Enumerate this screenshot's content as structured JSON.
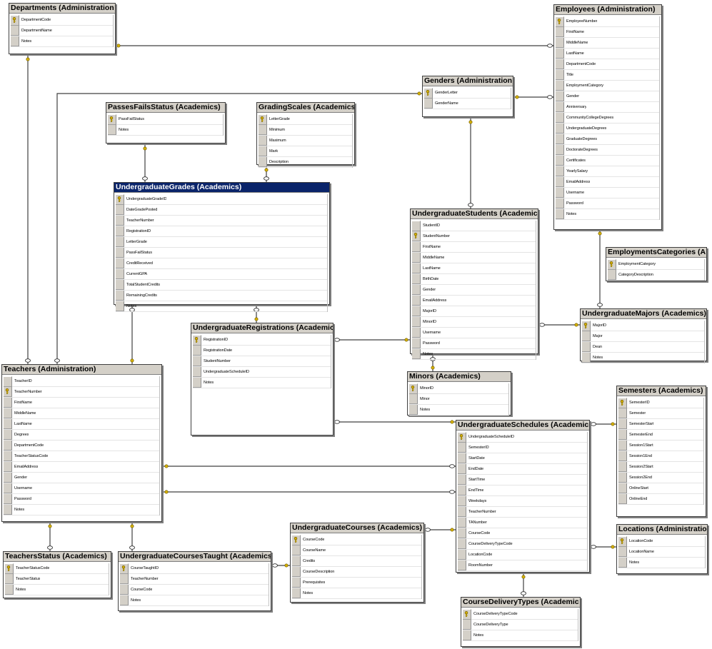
{
  "tables": [
    {
      "id": "departments",
      "title": "Departments (Administration",
      "columns": [
        {
          "name": "DepartmentCode",
          "pk": true
        },
        {
          "name": "DepartmentName",
          "pk": false
        },
        {
          "name": "Notes",
          "pk": false
        }
      ]
    },
    {
      "id": "employees",
      "title": "Employees (Administration)",
      "columns": [
        {
          "name": "EmployeeNumber",
          "pk": true
        },
        {
          "name": "FirstName",
          "pk": false
        },
        {
          "name": "MiddleName",
          "pk": false
        },
        {
          "name": "LastName",
          "pk": false
        },
        {
          "name": "DepartmentCode",
          "pk": false
        },
        {
          "name": "Title",
          "pk": false
        },
        {
          "name": "EmploymentCategory",
          "pk": false
        },
        {
          "name": "Gender",
          "pk": false
        },
        {
          "name": "Anniversary",
          "pk": false
        },
        {
          "name": "CommunityCollegeDegrees",
          "pk": false
        },
        {
          "name": "UndergraduateDegrees",
          "pk": false
        },
        {
          "name": "GraduateDegrees",
          "pk": false
        },
        {
          "name": "DoctorateDegrees",
          "pk": false
        },
        {
          "name": "Certificates",
          "pk": false
        },
        {
          "name": "YearlySalary",
          "pk": false
        },
        {
          "name": "EmailAddress",
          "pk": false
        },
        {
          "name": "Username",
          "pk": false
        },
        {
          "name": "Password",
          "pk": false
        },
        {
          "name": "Notes",
          "pk": false
        }
      ]
    },
    {
      "id": "genders",
      "title": "Genders (Administration",
      "columns": [
        {
          "name": "GenderLetter",
          "pk": true
        },
        {
          "name": "GenderName",
          "pk": false
        }
      ]
    },
    {
      "id": "passes",
      "title": "PassesFailsStatus (Academics)",
      "columns": [
        {
          "name": "PassFailStatus",
          "pk": true
        },
        {
          "name": "Notes",
          "pk": false
        }
      ]
    },
    {
      "id": "grading",
      "title": "GradingScales (Academics)",
      "columns": [
        {
          "name": "LetterGrade",
          "pk": true
        },
        {
          "name": "Minimum",
          "pk": false
        },
        {
          "name": "Maximum",
          "pk": false
        },
        {
          "name": "Mark",
          "pk": false
        },
        {
          "name": "Description",
          "pk": false
        }
      ]
    },
    {
      "id": "ugrades",
      "title": "UndergraduateGrades (Academics)",
      "selected": true,
      "columns": [
        {
          "name": "UndergraduateGradeID",
          "pk": true
        },
        {
          "name": "DateGradePosted",
          "pk": false
        },
        {
          "name": "TeacherNumber",
          "pk": false
        },
        {
          "name": "RegistrationID",
          "pk": false
        },
        {
          "name": "LetterGrade",
          "pk": false
        },
        {
          "name": "PassFailStatus",
          "pk": false
        },
        {
          "name": "CreditReceived",
          "pk": false
        },
        {
          "name": "CurrentGPA",
          "pk": false
        },
        {
          "name": "TotalStudentCredits",
          "pk": false
        },
        {
          "name": "RemainingCredits",
          "pk": false
        },
        {
          "name": "Notes",
          "pk": false
        }
      ]
    },
    {
      "id": "ustudents",
      "title": "UndergraduateStudents (Academics",
      "columns": [
        {
          "name": "StudentID",
          "pk": false
        },
        {
          "name": "StudentNumber",
          "pk": true
        },
        {
          "name": "FirstName",
          "pk": false
        },
        {
          "name": "MiddleName",
          "pk": false
        },
        {
          "name": "LastName",
          "pk": false
        },
        {
          "name": "BirthDate",
          "pk": false
        },
        {
          "name": "Gender",
          "pk": false
        },
        {
          "name": "EmailAddress",
          "pk": false
        },
        {
          "name": "MajorID",
          "pk": false
        },
        {
          "name": "MinorID",
          "pk": false
        },
        {
          "name": "Username",
          "pk": false
        },
        {
          "name": "Password",
          "pk": false
        },
        {
          "name": "Notes",
          "pk": false
        }
      ]
    },
    {
      "id": "empcat",
      "title": "EmploymentsCategories (A",
      "columns": [
        {
          "name": "EmploymentCategory",
          "pk": true
        },
        {
          "name": "CategoryDescription",
          "pk": false
        }
      ]
    },
    {
      "id": "umajors",
      "title": "UndergraduateMajors (Academics)",
      "columns": [
        {
          "name": "MajorID",
          "pk": true
        },
        {
          "name": "Major",
          "pk": false
        },
        {
          "name": "Dean",
          "pk": false
        },
        {
          "name": "Notes",
          "pk": false
        }
      ]
    },
    {
      "id": "uregs",
      "title": "UndergraduateRegistrations (Academic",
      "columns": [
        {
          "name": "RegistrationID",
          "pk": true
        },
        {
          "name": "RegistrationDate",
          "pk": false
        },
        {
          "name": "StudentNumber",
          "pk": false
        },
        {
          "name": "UndergraduateScheduleID",
          "pk": false
        },
        {
          "name": "Notes",
          "pk": false
        }
      ]
    },
    {
      "id": "teachers",
      "title": "Teachers (Administration)",
      "columns": [
        {
          "name": "TeacherID",
          "pk": false
        },
        {
          "name": "TeacherNumber",
          "pk": true
        },
        {
          "name": "FirstName",
          "pk": false
        },
        {
          "name": "MiddleName",
          "pk": false
        },
        {
          "name": "LastName",
          "pk": false
        },
        {
          "name": "Degrees",
          "pk": false
        },
        {
          "name": "DepartmentCode",
          "pk": false
        },
        {
          "name": "TeacherStatusCode",
          "pk": false
        },
        {
          "name": "EmailAddress",
          "pk": false
        },
        {
          "name": "Gender",
          "pk": false
        },
        {
          "name": "Username",
          "pk": false
        },
        {
          "name": "Password",
          "pk": false
        },
        {
          "name": "Notes",
          "pk": false
        }
      ]
    },
    {
      "id": "minors",
      "title": "Minors (Academics)",
      "columns": [
        {
          "name": "MinorID",
          "pk": true
        },
        {
          "name": "Minor",
          "pk": false
        },
        {
          "name": "Notes",
          "pk": false
        }
      ]
    },
    {
      "id": "semesters",
      "title": "Semesters (Academics)",
      "columns": [
        {
          "name": "SemesterID",
          "pk": true
        },
        {
          "name": "Semester",
          "pk": false
        },
        {
          "name": "SemesterStart",
          "pk": false
        },
        {
          "name": "SemesterEnd",
          "pk": false
        },
        {
          "name": "Session1Start",
          "pk": false
        },
        {
          "name": "Session1End",
          "pk": false
        },
        {
          "name": "Session2Start",
          "pk": false
        },
        {
          "name": "Session2End",
          "pk": false
        },
        {
          "name": "OnlineStart",
          "pk": false
        },
        {
          "name": "OnlineEnd",
          "pk": false
        }
      ]
    },
    {
      "id": "uschedules",
      "title": "UndergraduateSchedules (Academics",
      "columns": [
        {
          "name": "UndergraduateScheduleID",
          "pk": true
        },
        {
          "name": "SemesterID",
          "pk": false
        },
        {
          "name": "StartDate",
          "pk": false
        },
        {
          "name": "EndDate",
          "pk": false
        },
        {
          "name": "StartTime",
          "pk": false
        },
        {
          "name": "EndTime",
          "pk": false
        },
        {
          "name": "Weekdays",
          "pk": false
        },
        {
          "name": "TeacherNumber",
          "pk": false
        },
        {
          "name": "TANumber",
          "pk": false
        },
        {
          "name": "CourseCode",
          "pk": false
        },
        {
          "name": "CourseDeliveryTypeCode",
          "pk": false
        },
        {
          "name": "LocationCode",
          "pk": false
        },
        {
          "name": "RoomNumber",
          "pk": false
        }
      ]
    },
    {
      "id": "locations",
      "title": "Locations (Administration",
      "columns": [
        {
          "name": "LocationCode",
          "pk": true
        },
        {
          "name": "LocationName",
          "pk": false
        },
        {
          "name": "Notes",
          "pk": false
        }
      ]
    },
    {
      "id": "tstatus",
      "title": "TeachersStatus (Academics)",
      "columns": [
        {
          "name": "TeacherStatusCode",
          "pk": true
        },
        {
          "name": "TeacherStatus",
          "pk": false
        },
        {
          "name": "Notes",
          "pk": false
        }
      ]
    },
    {
      "id": "ucoursestaught",
      "title": "UndergraduateCoursesTaught (Academics",
      "columns": [
        {
          "name": "CourseTaughtID",
          "pk": true
        },
        {
          "name": "TeacherNumber",
          "pk": false
        },
        {
          "name": "CourseCode",
          "pk": false
        },
        {
          "name": "Notes",
          "pk": false
        }
      ]
    },
    {
      "id": "ucourses",
      "title": "UndergraduateCourses (Academics)",
      "columns": [
        {
          "name": "CourseCode",
          "pk": true
        },
        {
          "name": "CourseName",
          "pk": false
        },
        {
          "name": "Credits",
          "pk": false
        },
        {
          "name": "CourseDescription",
          "pk": false
        },
        {
          "name": "Prerequisites",
          "pk": false
        },
        {
          "name": "Notes",
          "pk": false
        }
      ]
    },
    {
      "id": "cdtypes",
      "title": "CourseDeliveryTypes (Academic",
      "columns": [
        {
          "name": "CourseDeliveryTypeCode",
          "pk": true
        },
        {
          "name": "CourseDeliveryType",
          "pk": false
        },
        {
          "name": "Notes",
          "pk": false
        }
      ]
    }
  ],
  "colors": {
    "title_bar": "#d4d0c8",
    "selected_title_bar": "#0a246a",
    "line": "#404040",
    "key": "#d4b000"
  }
}
